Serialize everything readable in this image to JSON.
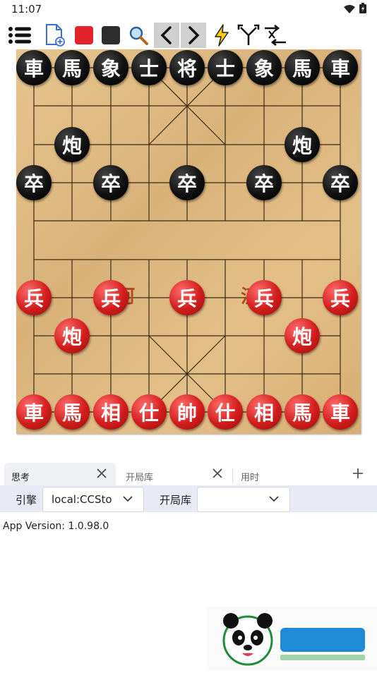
{
  "status": {
    "time": "11:07"
  },
  "board": {
    "river_left": "楚河",
    "river_right": "汉界",
    "black_back": [
      "車",
      "馬",
      "象",
      "士",
      "将",
      "士",
      "象",
      "馬",
      "車"
    ],
    "black_cannons": [
      "炮",
      "炮"
    ],
    "black_soldiers": [
      "卒",
      "卒",
      "卒",
      "卒",
      "卒"
    ],
    "red_soldiers": [
      "兵",
      "兵",
      "兵",
      "兵",
      "兵"
    ],
    "red_cannons": [
      "炮",
      "炮"
    ],
    "red_back": [
      "車",
      "馬",
      "相",
      "仕",
      "帥",
      "仕",
      "相",
      "馬",
      "車"
    ]
  },
  "tabs": [
    {
      "label": "思考",
      "active": true
    },
    {
      "label": "开局库",
      "active": false
    },
    {
      "label": "用时",
      "active": false
    }
  ],
  "engine": {
    "engine_label": "引擎",
    "engine_value": "local:CCSto",
    "book_label": "开局库",
    "book_value": ""
  },
  "version_text": "App Version: 1.0.98.0",
  "colors": {
    "accent": "#2196f3",
    "red": "#d21d1d",
    "black": "#111111",
    "board": "#e3bf88"
  }
}
